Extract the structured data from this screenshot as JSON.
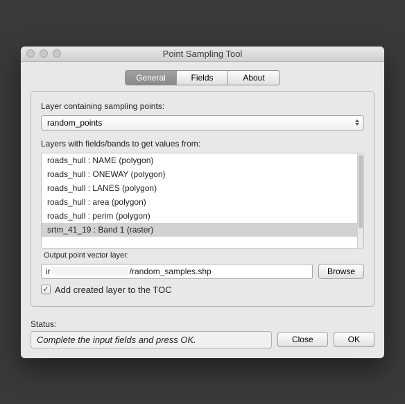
{
  "window": {
    "title": "Point Sampling Tool"
  },
  "tabs": {
    "general": "General",
    "fields": "Fields",
    "about": "About"
  },
  "panel": {
    "layer_label": "Layer containing sampling points:",
    "layer_selected": "random_points",
    "sources_label": "Layers with fields/bands to get values from:",
    "sources": [
      "roads_hull : NAME (polygon)",
      "roads_hull : ONEWAY (polygon)",
      "roads_hull : LANES (polygon)",
      "roads_hull : area (polygon)",
      "roads_hull : perim (polygon)",
      "srtm_41_19 : Band 1 (raster)"
    ],
    "output_label": "Output point vector layer:",
    "output_prefix": "ir",
    "output_suffix": "/random_samples.shp",
    "browse": "Browse",
    "add_toc": "Add created layer to the TOC"
  },
  "footer": {
    "status_label": "Status:",
    "status": "Complete the input fields and press OK.",
    "close": "Close",
    "ok": "OK"
  }
}
